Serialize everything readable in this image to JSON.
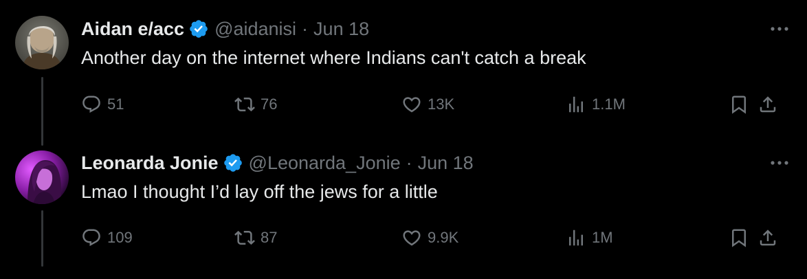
{
  "colors": {
    "background": "#000000",
    "primary_text": "#e7e9ea",
    "secondary_text": "#71767b",
    "verified_badge": "#1d9bf0",
    "thread_line": "#333639"
  },
  "tweets": [
    {
      "display_name": "Aidan e/acc",
      "verified": true,
      "handle": "@aidanisi",
      "separator": "·",
      "date": "Jun 18",
      "text": "Another day on the internet where Indians can't catch a break",
      "avatar_icon": "avatar-gray-haired-man",
      "stats": {
        "replies": "51",
        "reposts": "76",
        "likes": "13K",
        "views": "1.1M"
      }
    },
    {
      "display_name": "Leonarda Jonie",
      "verified": true,
      "handle": "@Leonarda_Jonie",
      "separator": "·",
      "date": "Jun 18",
      "text": "Lmao I thought I’d lay off the jews for a little",
      "avatar_icon": "avatar-woman-purple-light",
      "stats": {
        "replies": "109",
        "reposts": "87",
        "likes": "9.9K",
        "views": "1M"
      }
    }
  ],
  "icons": {
    "reply": "reply-icon",
    "repost": "repost-icon",
    "like": "heart-icon",
    "views": "views-icon",
    "bookmark": "bookmark-icon",
    "share": "share-icon",
    "more": "more-icon",
    "verified": "verified-badge-icon"
  }
}
